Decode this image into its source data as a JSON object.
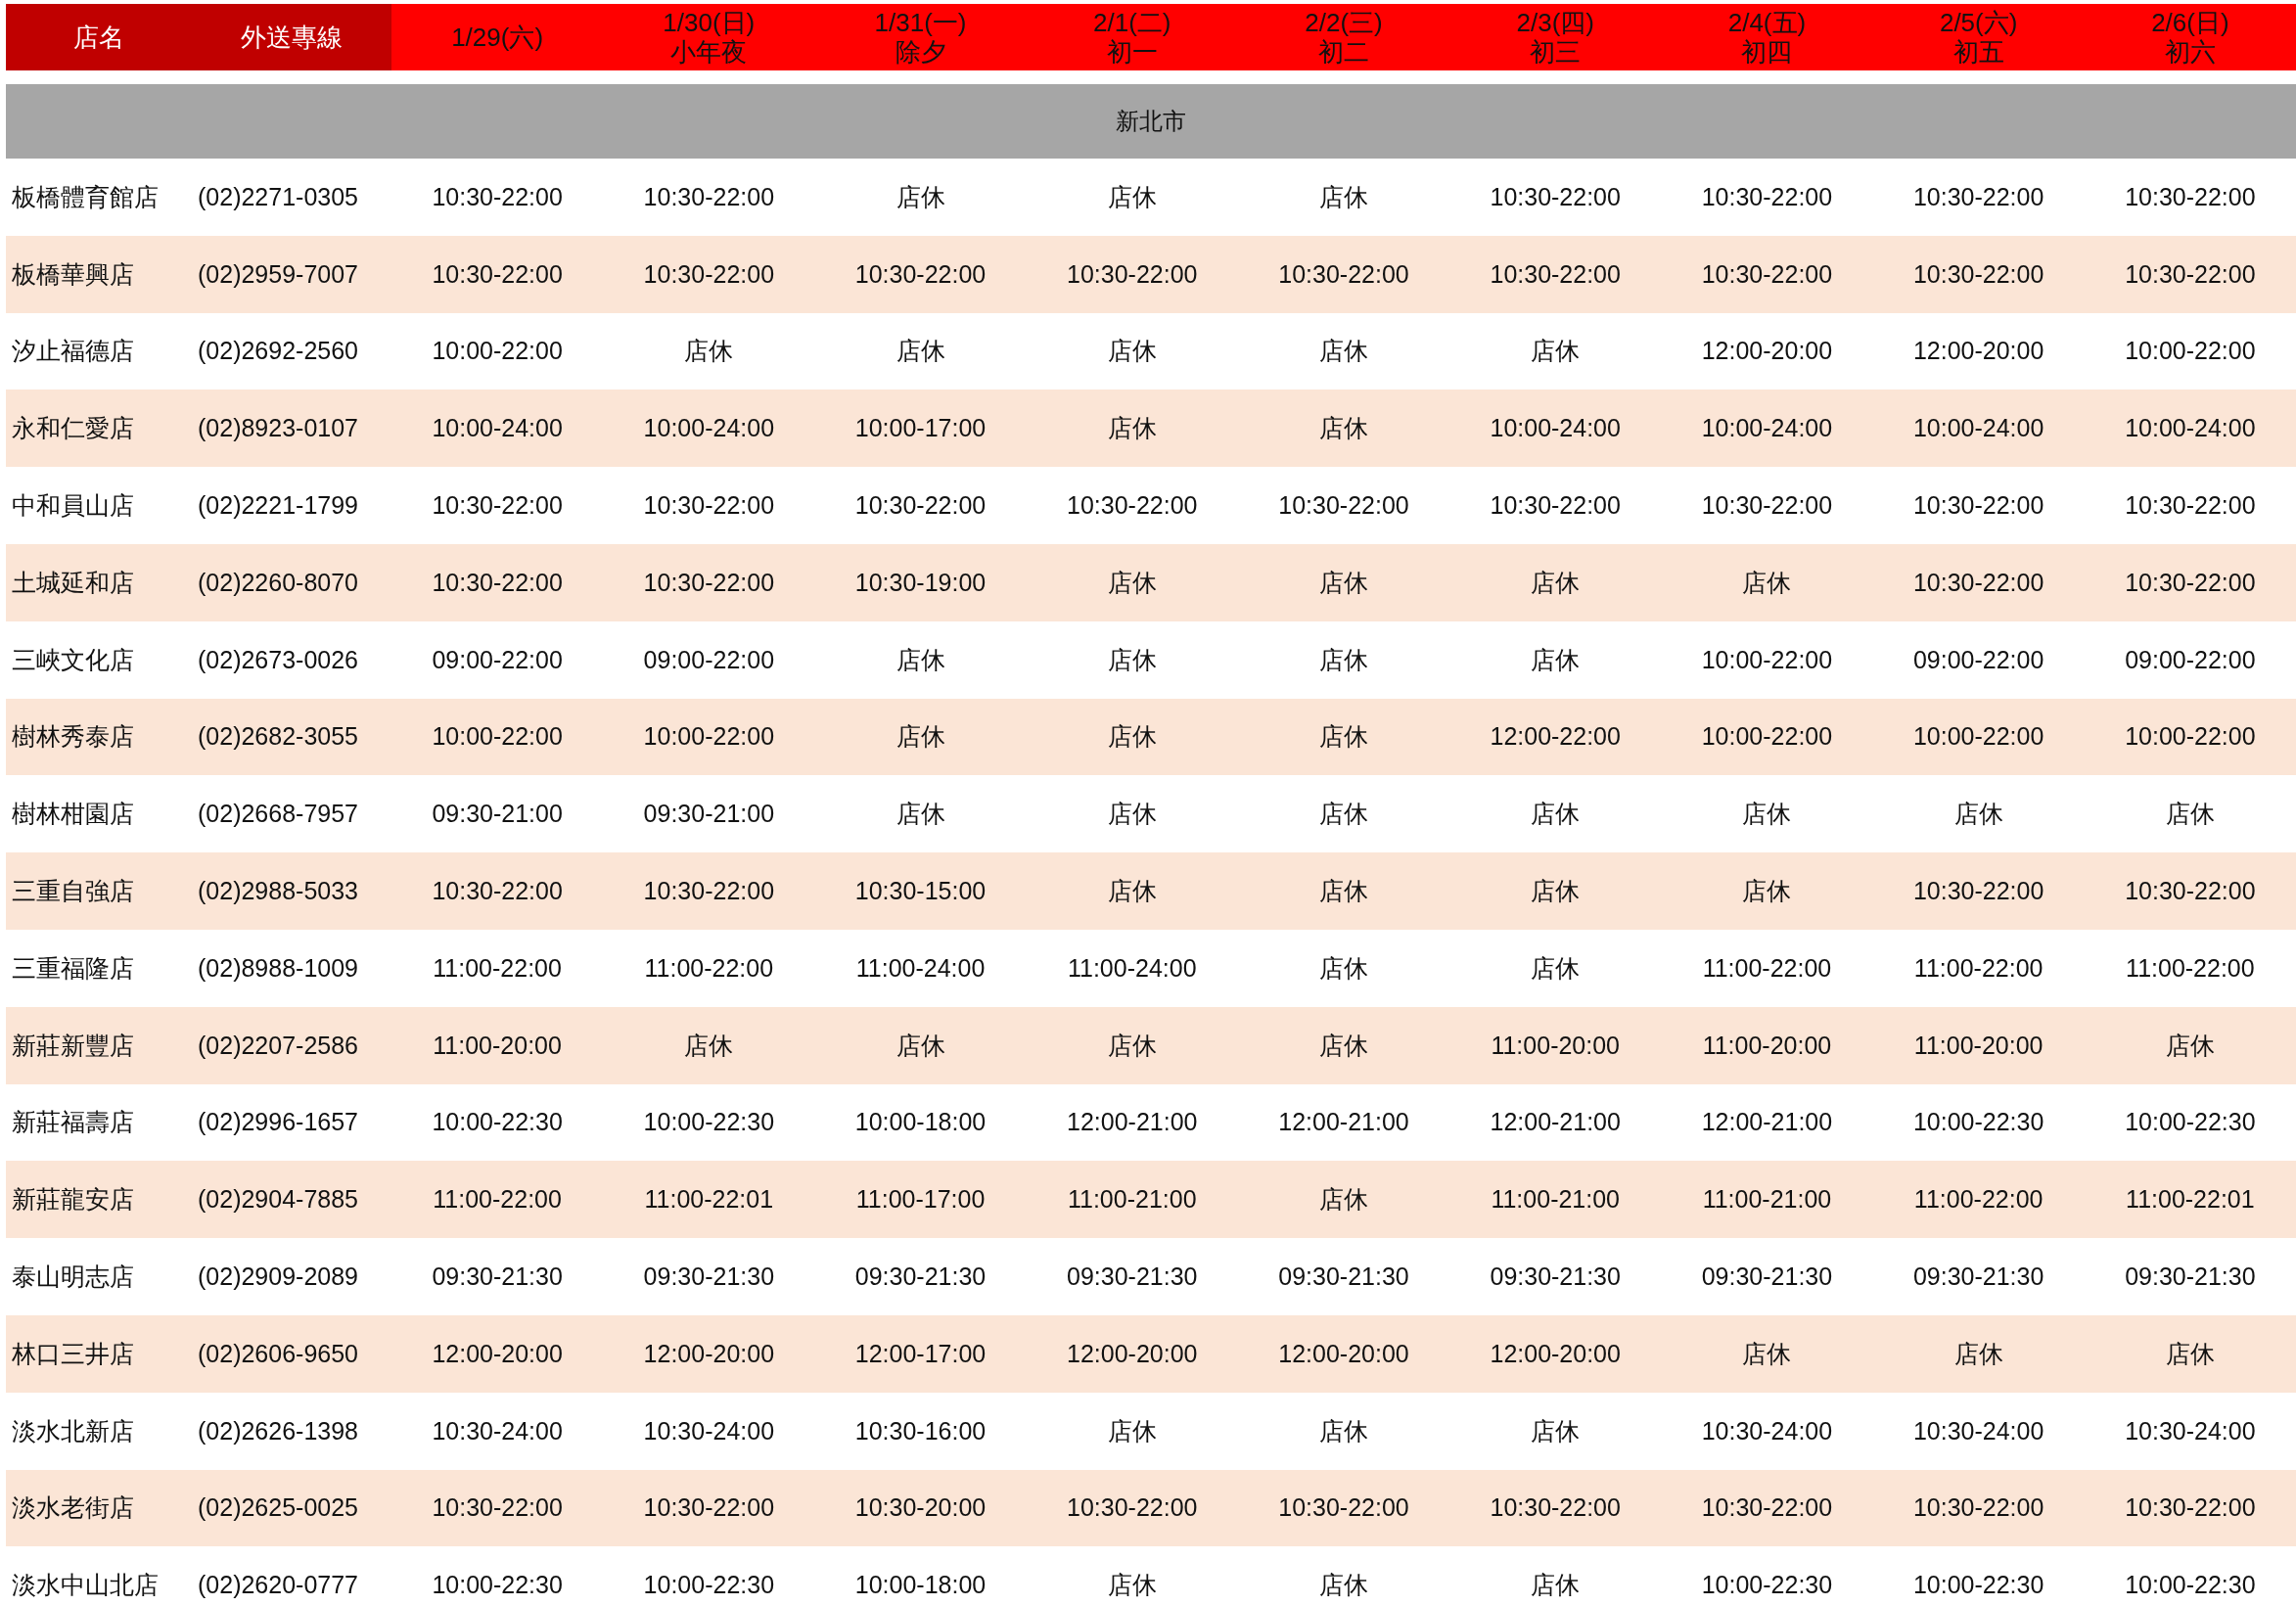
{
  "header": {
    "columns": [
      {
        "line1": "店名",
        "kind": "info"
      },
      {
        "line1": "外送專線",
        "kind": "info"
      },
      {
        "line1": "1/29(六)",
        "kind": "date"
      },
      {
        "line1": "1/30(日)",
        "line2": "小年夜",
        "kind": "date"
      },
      {
        "line1": "1/31(一)",
        "line2": "除夕",
        "kind": "date"
      },
      {
        "line1": "2/1(二)",
        "line2": "初一",
        "kind": "date"
      },
      {
        "line1": "2/2(三)",
        "line2": "初二",
        "kind": "date"
      },
      {
        "line1": "2/3(四)",
        "line2": "初三",
        "kind": "date"
      },
      {
        "line1": "2/4(五)",
        "line2": "初四",
        "kind": "date"
      },
      {
        "line1": "2/5(六)",
        "line2": "初五",
        "kind": "date"
      },
      {
        "line1": "2/6(日)",
        "line2": "初六",
        "kind": "date"
      }
    ]
  },
  "region": "新北市",
  "rows": [
    {
      "name": "板橋體育館店",
      "phone": "(02)2271-0305",
      "hours": [
        "10:30-22:00",
        "10:30-22:00",
        "店休",
        "店休",
        "店休",
        "10:30-22:00",
        "10:30-22:00",
        "10:30-22:00",
        "10:30-22:00"
      ]
    },
    {
      "name": "板橋華興店",
      "phone": "(02)2959-7007",
      "hours": [
        "10:30-22:00",
        "10:30-22:00",
        "10:30-22:00",
        "10:30-22:00",
        "10:30-22:00",
        "10:30-22:00",
        "10:30-22:00",
        "10:30-22:00",
        "10:30-22:00"
      ]
    },
    {
      "name": "汐止福德店",
      "phone": "(02)2692-2560",
      "hours": [
        "10:00-22:00",
        "店休",
        "店休",
        "店休",
        "店休",
        "店休",
        "12:00-20:00",
        "12:00-20:00",
        "10:00-22:00"
      ]
    },
    {
      "name": "永和仁愛店",
      "phone": "(02)8923-0107",
      "hours": [
        "10:00-24:00",
        "10:00-24:00",
        "10:00-17:00",
        "店休",
        "店休",
        "10:00-24:00",
        "10:00-24:00",
        "10:00-24:00",
        "10:00-24:00"
      ]
    },
    {
      "name": "中和員山店",
      "phone": "(02)2221-1799",
      "hours": [
        "10:30-22:00",
        "10:30-22:00",
        "10:30-22:00",
        "10:30-22:00",
        "10:30-22:00",
        "10:30-22:00",
        "10:30-22:00",
        "10:30-22:00",
        "10:30-22:00"
      ]
    },
    {
      "name": "土城延和店",
      "phone": "(02)2260-8070",
      "hours": [
        "10:30-22:00",
        "10:30-22:00",
        "10:30-19:00",
        "店休",
        "店休",
        "店休",
        "店休",
        "10:30-22:00",
        "10:30-22:00"
      ]
    },
    {
      "name": "三峽文化店",
      "phone": "(02)2673-0026",
      "hours": [
        "09:00-22:00",
        "09:00-22:00",
        "店休",
        "店休",
        "店休",
        "店休",
        "10:00-22:00",
        "09:00-22:00",
        "09:00-22:00"
      ]
    },
    {
      "name": "樹林秀泰店",
      "phone": "(02)2682-3055",
      "hours": [
        "10:00-22:00",
        "10:00-22:00",
        "店休",
        "店休",
        "店休",
        "12:00-22:00",
        "10:00-22:00",
        "10:00-22:00",
        "10:00-22:00"
      ]
    },
    {
      "name": "樹林柑園店",
      "phone": "(02)2668-7957",
      "hours": [
        "09:30-21:00",
        "09:30-21:00",
        "店休",
        "店休",
        "店休",
        "店休",
        "店休",
        "店休",
        "店休"
      ]
    },
    {
      "name": "三重自強店",
      "phone": "(02)2988-5033",
      "hours": [
        "10:30-22:00",
        "10:30-22:00",
        "10:30-15:00",
        "店休",
        "店休",
        "店休",
        "店休",
        "10:30-22:00",
        "10:30-22:00"
      ]
    },
    {
      "name": "三重福隆店",
      "phone": "(02)8988-1009",
      "hours": [
        "11:00-22:00",
        "11:00-22:00",
        "11:00-24:00",
        "11:00-24:00",
        "店休",
        "店休",
        "11:00-22:00",
        "11:00-22:00",
        "11:00-22:00"
      ]
    },
    {
      "name": "新莊新豐店",
      "phone": "(02)2207-2586",
      "hours": [
        "11:00-20:00",
        "店休",
        "店休",
        "店休",
        "店休",
        "11:00-20:00",
        "11:00-20:00",
        "11:00-20:00",
        "店休"
      ]
    },
    {
      "name": "新莊福壽店",
      "phone": "(02)2996-1657",
      "hours": [
        "10:00-22:30",
        "10:00-22:30",
        "10:00-18:00",
        "12:00-21:00",
        "12:00-21:00",
        "12:00-21:00",
        "12:00-21:00",
        "10:00-22:30",
        "10:00-22:30"
      ]
    },
    {
      "name": "新莊龍安店",
      "phone": "(02)2904-7885",
      "hours": [
        "11:00-22:00",
        "11:00-22:01",
        "11:00-17:00",
        "11:00-21:00",
        "店休",
        "11:00-21:00",
        "11:00-21:00",
        "11:00-22:00",
        "11:00-22:01"
      ]
    },
    {
      "name": "泰山明志店",
      "phone": "(02)2909-2089",
      "hours": [
        "09:30-21:30",
        "09:30-21:30",
        "09:30-21:30",
        "09:30-21:30",
        "09:30-21:30",
        "09:30-21:30",
        "09:30-21:30",
        "09:30-21:30",
        "09:30-21:30"
      ]
    },
    {
      "name": "林口三井店",
      "phone": "(02)2606-9650",
      "hours": [
        "12:00-20:00",
        "12:00-20:00",
        "12:00-17:00",
        "12:00-20:00",
        "12:00-20:00",
        "12:00-20:00",
        "店休",
        "店休",
        "店休"
      ]
    },
    {
      "name": "淡水北新店",
      "phone": "(02)2626-1398",
      "hours": [
        "10:30-24:00",
        "10:30-24:00",
        "10:30-16:00",
        "店休",
        "店休",
        "店休",
        "10:30-24:00",
        "10:30-24:00",
        "10:30-24:00"
      ]
    },
    {
      "name": "淡水老街店",
      "phone": "(02)2625-0025",
      "hours": [
        "10:30-22:00",
        "10:30-22:00",
        "10:30-20:00",
        "10:30-22:00",
        "10:30-22:00",
        "10:30-22:00",
        "10:30-22:00",
        "10:30-22:00",
        "10:30-22:00"
      ]
    },
    {
      "name": "淡水中山北店",
      "phone": "(02)2620-0777",
      "hours": [
        "10:00-22:30",
        "10:00-22:30",
        "10:00-18:00",
        "店休",
        "店休",
        "店休",
        "10:00-22:30",
        "10:00-22:30",
        "10:00-22:30"
      ]
    }
  ]
}
